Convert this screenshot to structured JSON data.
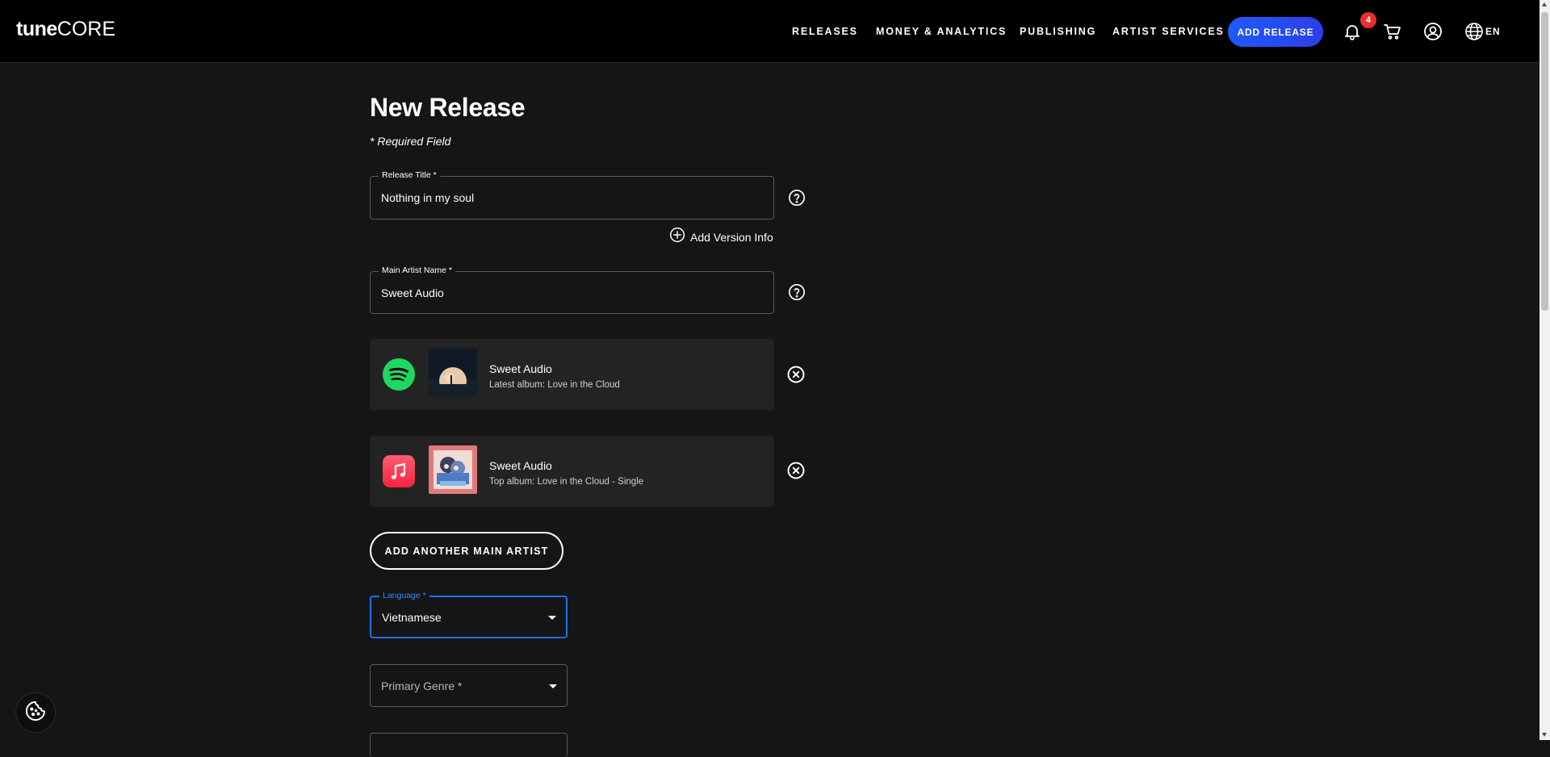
{
  "header": {
    "logo_tune": "tune",
    "logo_core": "CORE",
    "nav": {
      "releases": "RELEASES",
      "money": "MONEY & ANALYTICS",
      "publishing": "PUBLISHING",
      "artist_services": "ARTIST SERVICES"
    },
    "add_release": "ADD RELEASE",
    "notification_count": "4",
    "language": "EN",
    "icons": [
      "bell-icon",
      "cart-icon",
      "user-icon",
      "globe-icon"
    ]
  },
  "page": {
    "title": "New Release",
    "required_note": "* Required Field"
  },
  "form": {
    "release_title": {
      "label": "Release Title *",
      "value": "Nothing in my soul"
    },
    "add_version_info": "Add Version Info",
    "main_artist": {
      "label": "Main Artist Name *",
      "value": "Sweet Audio"
    },
    "artist_cards": [
      {
        "service": "spotify",
        "name": "Sweet Audio",
        "subtitle": "Latest album: Love in the Cloud"
      },
      {
        "service": "apple-music",
        "name": "Sweet Audio",
        "subtitle": "Top album: Love in the Cloud - Single"
      }
    ],
    "add_another_artist": "ADD ANOTHER MAIN ARTIST",
    "language": {
      "label": "Language *",
      "value": "Vietnamese"
    },
    "primary_genre": {
      "placeholder": "Primary Genre *"
    }
  },
  "colors": {
    "accent_blue": "#1e5bff",
    "badge_red": "#e5302b",
    "spotify_green": "#1ed760",
    "apple_music_red": "#fa2d48",
    "background": "#151515"
  }
}
